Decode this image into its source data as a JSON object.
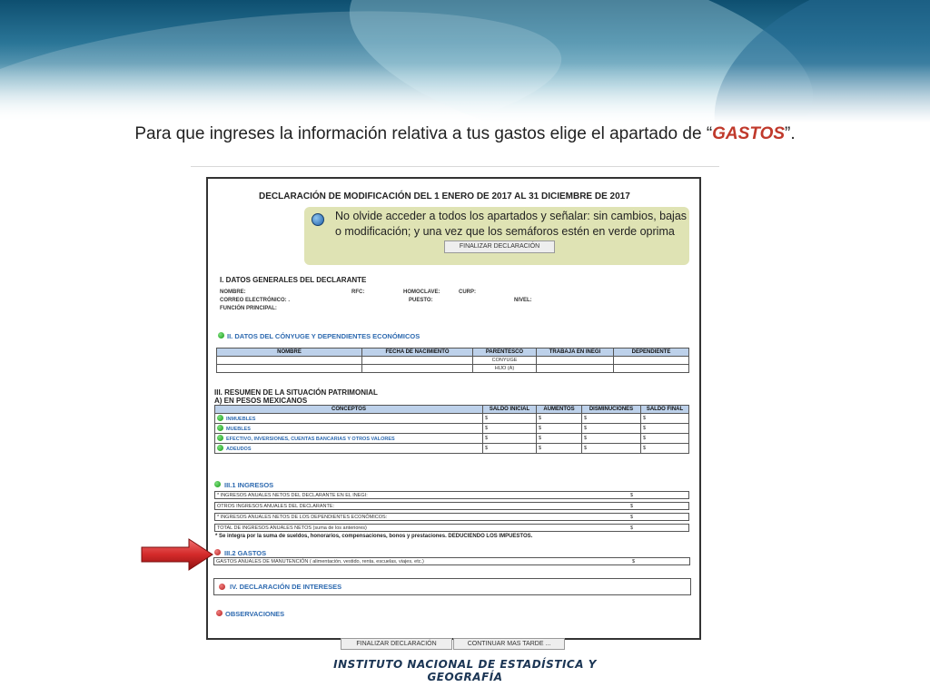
{
  "slide": {
    "instruction_prefix": "Para que ingreses la información relativa a tus gastos elige el apartado de “",
    "instruction_highlight": "GASTOS",
    "instruction_suffix": "”.",
    "footer_logo": "INSTITUTO NACIONAL  DE ESTADÍSTICA Y GEOGRAFÍA"
  },
  "form": {
    "title": "DECLARACIÓN DE MODIFICACIÓN DEL 1 ENERO DE 2017 AL 31 DICIEMBRE DE 2017",
    "notice_text": "No olvide acceder a todos los apartados y señalar: sin cambios, bajas o modificación; y una vez que los semáforos estén en verde oprima",
    "finalize_button": "FINALIZAR DECLARACIÓN",
    "section1": {
      "title": "I. DATOS GENERALES DEL DECLARANTE",
      "nombre": "NOMBRE:",
      "rfc": "RFC:",
      "homoclave": "HOMOCLAVE:",
      "curp": "CURP:",
      "correo": "CORREO ELECTRÓNICO: .",
      "puesto": "PUESTO:",
      "nivel": "NIVEL:",
      "funcion": "FUNCIÓN PRINCIPAL:"
    },
    "section2": {
      "title": "II. DATOS DEL CÓNYUGE Y DEPENDIENTES ECONÓMICOS",
      "headers": [
        "NOMBRE",
        "FECHA DE NACIMIENTO",
        "PARENTESCO",
        "TRABAJA EN INEGI",
        "DEPENDIENTE"
      ],
      "rows": [
        [
          "",
          "",
          "CONYUGE",
          "",
          ""
        ],
        [
          "",
          "",
          "HIJO (A)",
          "",
          ""
        ]
      ]
    },
    "section3": {
      "title": "III. RESUMEN DE LA SITUACIÓN PATRIMONIAL",
      "subtitle": "A) EN PESOS MEXICANOS",
      "headers": [
        "CONCEPTOS",
        "SALDO INICIAL",
        "AUMENTOS",
        "DISMINUCIONES",
        "SALDO FINAL"
      ],
      "rows": [
        {
          "label": "INMUEBLES",
          "cells": [
            "$",
            "$",
            "$",
            "$"
          ]
        },
        {
          "label": "MUEBLES",
          "cells": [
            "$",
            "$",
            "$",
            "$"
          ]
        },
        {
          "label": "EFECTIVO, INVERSIONES, CUENTAS BANCARIAS Y OTROS VALORES",
          "cells": [
            "$",
            "$",
            "$",
            "$"
          ]
        },
        {
          "label": "ADEUDOS",
          "cells": [
            "$",
            "$",
            "$",
            "$"
          ]
        }
      ]
    },
    "ingresos": {
      "title": "III.1 INGRESOS",
      "rows": [
        {
          "label": "* INGRESOS ANUALES NETOS DEL DECLARANTE EN EL INEGI:",
          "value": "$"
        },
        {
          "label": "OTROS INGRESOS ANUALES DEL DECLARANTE:",
          "value": "$"
        },
        {
          "label": "* INGRESOS ANUALES NETOS DE LOS DEPENDIENTES ECONÓMICOS:",
          "value": "$"
        },
        {
          "label": "TOTAL DE INGRESOS ANUALES NETOS (suma de los anteriores)",
          "value": "$"
        }
      ],
      "note": "* Se integra por la suma de sueldos, honorarios, compensaciones, bonos y prestaciones. DEDUCIENDO LOS IMPUESTOS."
    },
    "gastos": {
      "title": "III.2 GASTOS",
      "row_label": "GASTOS ANUALES DE MANUTENCIÓN ( alimentación, vestido, renta, escuelas, viajes, etc.)",
      "row_value": "$"
    },
    "section4": {
      "title": "IV. DECLARACIÓN DE INTERESES"
    },
    "observaciones": {
      "title": "OBSERVACIONES"
    },
    "bottom_buttons": {
      "finalize": "FINALIZAR DECLARACIÓN",
      "continue": "CONTINUAR MAS TARDE ..."
    }
  },
  "colors": {
    "accent_red": "#c0392b",
    "link_blue": "#2e6ab0",
    "header_blue": "#bdd1ea",
    "notice_bg": "#dfe3b4",
    "logo_navy": "#1b3554"
  }
}
